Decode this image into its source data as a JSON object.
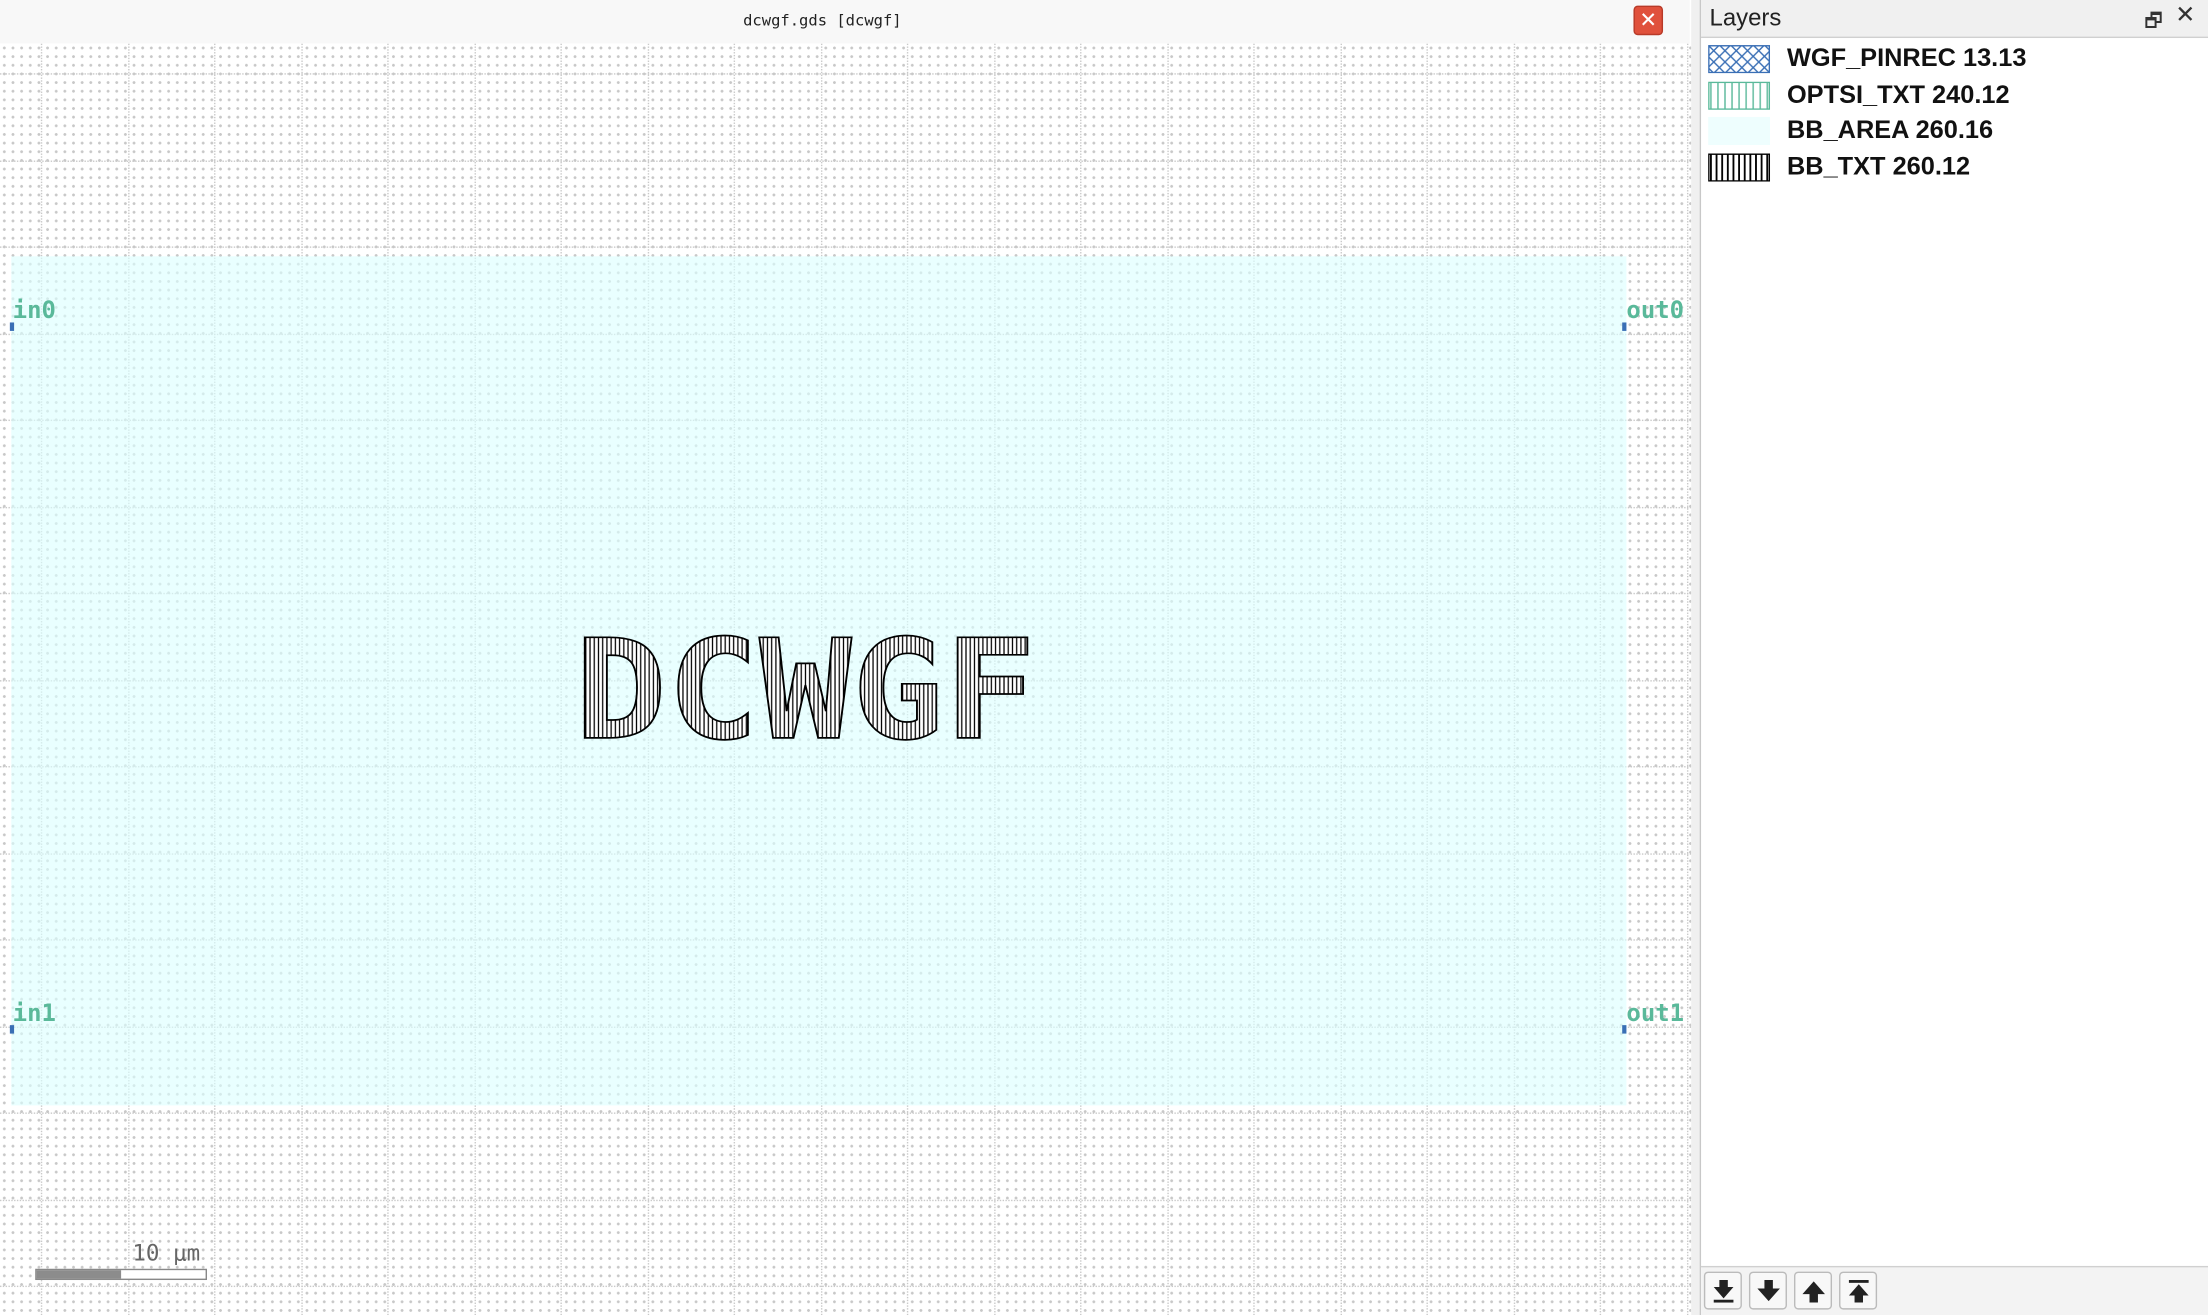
{
  "window": {
    "document_title": "dcwgf.gds [dcwgf]"
  },
  "layout": {
    "cell_label_text": "DCWGF",
    "ports": {
      "in0": "in0",
      "out0": "out0",
      "in1": "in1",
      "out1": "out1"
    },
    "scale_bar": {
      "label": "10 μm"
    }
  },
  "layers_panel": {
    "title": "Layers",
    "layers": [
      {
        "name": "WGF_PINREC 13.13",
        "pattern": "crosshatch",
        "color": "#3a6fb5"
      },
      {
        "name": "OPTSI_TXT 240.12",
        "pattern": "vertical",
        "color": "#5ab99a"
      },
      {
        "name": "BB_AREA 260.16",
        "pattern": "solid",
        "color": "#dcffff"
      },
      {
        "name": "BB_TXT 260.12",
        "pattern": "vertical",
        "color": "#000000"
      }
    ],
    "footer_buttons": [
      "move-to-bottom",
      "move-down",
      "move-up",
      "move-to-top"
    ]
  },
  "colors": {
    "bb_area_fill": "#dcffff",
    "port_label": "#5ab99a",
    "pin_marker": "#3a6fb5",
    "close_button": "#e0513c"
  }
}
